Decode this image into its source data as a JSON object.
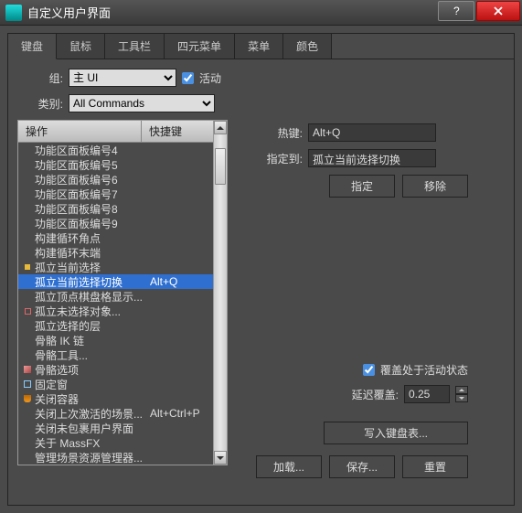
{
  "title": "自定义用户界面",
  "tabs": [
    "键盘",
    "鼠标",
    "工具栏",
    "四元菜单",
    "菜单",
    "颜色"
  ],
  "activeTab": 0,
  "labels": {
    "group": "组:",
    "active": "活动",
    "category": "类别:",
    "hotkey": "热键:",
    "assignedTo": "指定到:",
    "assign": "指定",
    "remove": "移除",
    "overrideActive": "覆盖处于活动状态",
    "delayOverride": "延迟覆盖:",
    "writeKeyboard": "写入键盘表...",
    "load": "加载...",
    "save": "保存...",
    "reset": "重置"
  },
  "group": {
    "value": "主 UI"
  },
  "activeChecked": true,
  "category": {
    "value": "All Commands"
  },
  "listHeader": {
    "action": "操作",
    "shortcut": "快捷键"
  },
  "hotkeyValue": "Alt+Q",
  "assignedValue": "孤立当前选择切换",
  "overrideChecked": true,
  "delayValue": "0.25",
  "list": [
    {
      "label": "功能区面板编号4",
      "shortcut": "",
      "icon": ""
    },
    {
      "label": "功能区面板编号5",
      "shortcut": "",
      "icon": ""
    },
    {
      "label": "功能区面板编号6",
      "shortcut": "",
      "icon": ""
    },
    {
      "label": "功能区面板编号7",
      "shortcut": "",
      "icon": ""
    },
    {
      "label": "功能区面板编号8",
      "shortcut": "",
      "icon": ""
    },
    {
      "label": "功能区面板编号9",
      "shortcut": "",
      "icon": ""
    },
    {
      "label": "构建循环角点",
      "shortcut": "",
      "icon": ""
    },
    {
      "label": "构建循环末端",
      "shortcut": "",
      "icon": ""
    },
    {
      "label": "孤立当前选择",
      "shortcut": "",
      "icon": "dot"
    },
    {
      "label": "孤立当前选择切换",
      "shortcut": "Alt+Q",
      "icon": "",
      "selected": true
    },
    {
      "label": "孤立顶点棋盘格显示...",
      "shortcut": "",
      "icon": ""
    },
    {
      "label": "孤立未选择对象...",
      "shortcut": "",
      "icon": "sq"
    },
    {
      "label": "孤立选择的层",
      "shortcut": "",
      "icon": ""
    },
    {
      "label": "骨骼 IK 链",
      "shortcut": "",
      "icon": ""
    },
    {
      "label": "骨骼工具...",
      "shortcut": "",
      "icon": ""
    },
    {
      "label": "骨骼选项",
      "shortcut": "",
      "icon": "cube"
    },
    {
      "label": "固定窗",
      "shortcut": "",
      "icon": "wire"
    },
    {
      "label": "关闭容器",
      "shortcut": "",
      "icon": "vessel"
    },
    {
      "label": "关闭上次激活的场景...",
      "shortcut": "Alt+Ctrl+P",
      "icon": ""
    },
    {
      "label": "关闭未包裹用户界面",
      "shortcut": "",
      "icon": ""
    },
    {
      "label": "关于 MassFX",
      "shortcut": "",
      "icon": ""
    },
    {
      "label": "管理场景资源管理器...",
      "shortcut": "",
      "icon": ""
    }
  ]
}
